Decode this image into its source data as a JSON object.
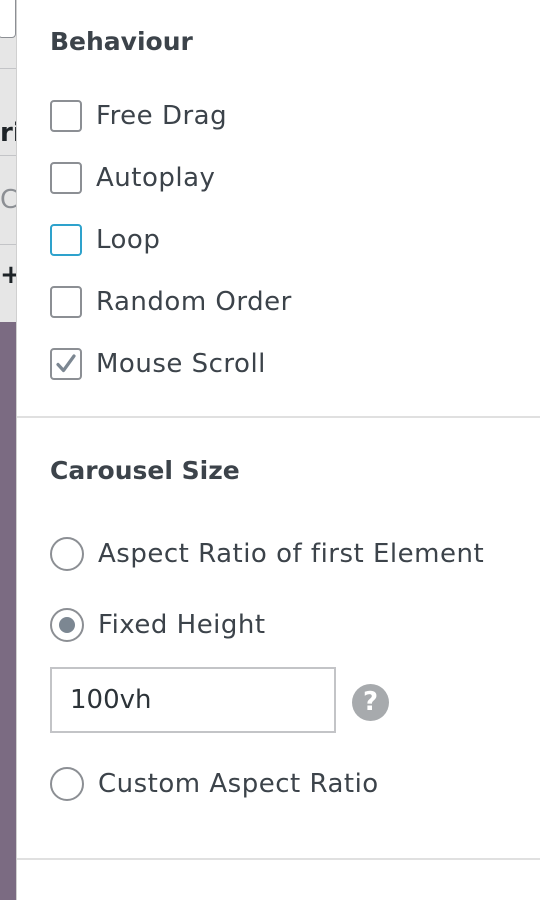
{
  "backdrop": {
    "fragment_1": "ri",
    "fragment_2": "Co",
    "fragment_3": "+"
  },
  "behaviour": {
    "title": "Behaviour",
    "options": [
      {
        "label": "Free Drag",
        "checked": false
      },
      {
        "label": "Autoplay",
        "checked": false
      },
      {
        "label": "Loop",
        "checked": false,
        "focused": true
      },
      {
        "label": "Random Order",
        "checked": false
      },
      {
        "label": "Mouse Scroll",
        "checked": true
      }
    ]
  },
  "carousel_size": {
    "title": "Carousel Size",
    "options": [
      {
        "label": "Aspect Ratio of first Element",
        "selected": false
      },
      {
        "label": "Fixed Height",
        "selected": true
      },
      {
        "label": "Custom Aspect Ratio",
        "selected": false
      }
    ],
    "height_value": "100vh",
    "help_glyph": "?"
  },
  "colors": {
    "focus": "#2ea2cc",
    "border": "#8c8f94",
    "text": "#3c434a",
    "backdrop": "#7b6b82"
  }
}
